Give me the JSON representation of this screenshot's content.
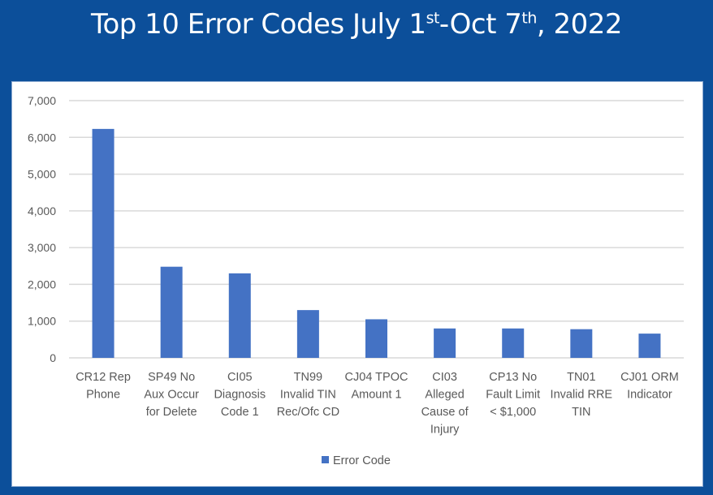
{
  "title": {
    "main": "Top 10 Error Codes July 1",
    "sup1": "st",
    "mid": "-Oct 7",
    "sup2": "th",
    "end": ", 2022"
  },
  "colors": {
    "background": "#0c4f9a",
    "bar": "#4472c4",
    "grid": "#d9d9d9"
  },
  "chart_data": {
    "type": "bar",
    "title": "Top 10 Error Codes July 1st-Oct 7th, 2022",
    "categories": [
      [
        "CR12 Rep",
        "Phone"
      ],
      [
        "SP49 No",
        "Aux Occur",
        "for Delete"
      ],
      [
        "CI05",
        "Diagnosis",
        "Code 1"
      ],
      [
        "TN99",
        "Invalid TIN",
        "Rec/Ofc CD"
      ],
      [
        "CJ04 TPOC",
        "Amount 1"
      ],
      [
        "CI03",
        "Alleged",
        "Cause of",
        "Injury"
      ],
      [
        "CP13 No",
        "Fault Limit",
        "< $1,000"
      ],
      [
        "TN01",
        "Invalid RRE",
        "TIN"
      ],
      [
        "CJ01 ORM",
        "Indicator"
      ]
    ],
    "series": [
      {
        "name": "Error Code",
        "values": [
          6230,
          2480,
          2300,
          1300,
          1050,
          800,
          800,
          780,
          660
        ]
      }
    ],
    "yticks": [
      "0",
      "1,000",
      "2,000",
      "3,000",
      "4,000",
      "5,000",
      "6,000",
      "7,000"
    ],
    "ylim": [
      0,
      7000
    ],
    "grid": true,
    "legend": "bottom"
  }
}
